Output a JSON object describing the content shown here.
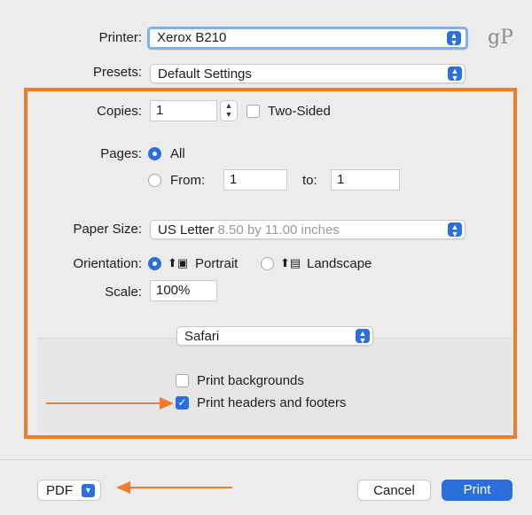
{
  "watermark": "gP",
  "printer": {
    "label": "Printer:",
    "value": "Xerox B210"
  },
  "presets": {
    "label": "Presets:",
    "value": "Default Settings"
  },
  "copies": {
    "label": "Copies:",
    "value": "1",
    "two_sided_label": "Two-Sided",
    "two_sided_checked": false
  },
  "pages": {
    "label": "Pages:",
    "all_label": "All",
    "from_label": "From:",
    "from_value": "1",
    "to_label": "to:",
    "to_value": "1",
    "selected": "All"
  },
  "paper_size": {
    "label": "Paper Size:",
    "value": "US Letter",
    "detail": "8.50 by 11.00 inches"
  },
  "orientation": {
    "label": "Orientation:",
    "portrait_label": "Portrait",
    "landscape_label": "Landscape",
    "selected": "Portrait"
  },
  "scale": {
    "label": "Scale:",
    "value": "100%"
  },
  "app_section": {
    "value": "Safari"
  },
  "options": {
    "print_backgrounds_label": "Print backgrounds",
    "print_backgrounds_checked": false,
    "print_headers_label": "Print headers and footers",
    "print_headers_checked": true
  },
  "footer": {
    "pdf_label": "PDF",
    "cancel_label": "Cancel",
    "print_label": "Print"
  },
  "colors": {
    "accent": "#2a6fdc",
    "highlight": "#f07d2e",
    "background": "#ececec"
  }
}
